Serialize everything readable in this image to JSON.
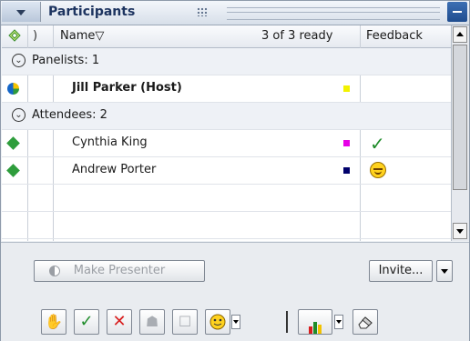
{
  "panel": {
    "title": "Participants"
  },
  "table": {
    "col_name": "Name",
    "sort_indicator": "▽",
    "ready_count": "3 of 3 ready",
    "col_feedback": "Feedback"
  },
  "groups": [
    {
      "label": "Panelists: 1"
    },
    {
      "label": "Attendees: 2"
    }
  ],
  "participants": [
    {
      "name": "Jill Parker (Host)",
      "color": "#f2f200",
      "status_icon": "host-pie-icon",
      "feedback": ""
    },
    {
      "name": "Cynthia King",
      "color": "#e600e6",
      "status_icon": "green-diamond-icon",
      "feedback": "checkmark-icon"
    },
    {
      "name": "Andrew Porter",
      "color": "#00006b",
      "status_icon": "green-diamond-icon",
      "feedback": "smile-emoticon-icon"
    }
  ],
  "actions": {
    "make_presenter": "Make Presenter",
    "invite": "Invite..."
  },
  "toolbar_icons": [
    "raise-hand-icon",
    "checkmark-icon",
    "x-icon",
    "step-away-icon",
    "applause-icon",
    "emoticon-icon",
    "poll-chart-icon",
    "eraser-icon"
  ],
  "colors": {
    "title_text": "#1d3460",
    "check_green": "#1f8c2a",
    "x_red": "#d81e1e"
  }
}
